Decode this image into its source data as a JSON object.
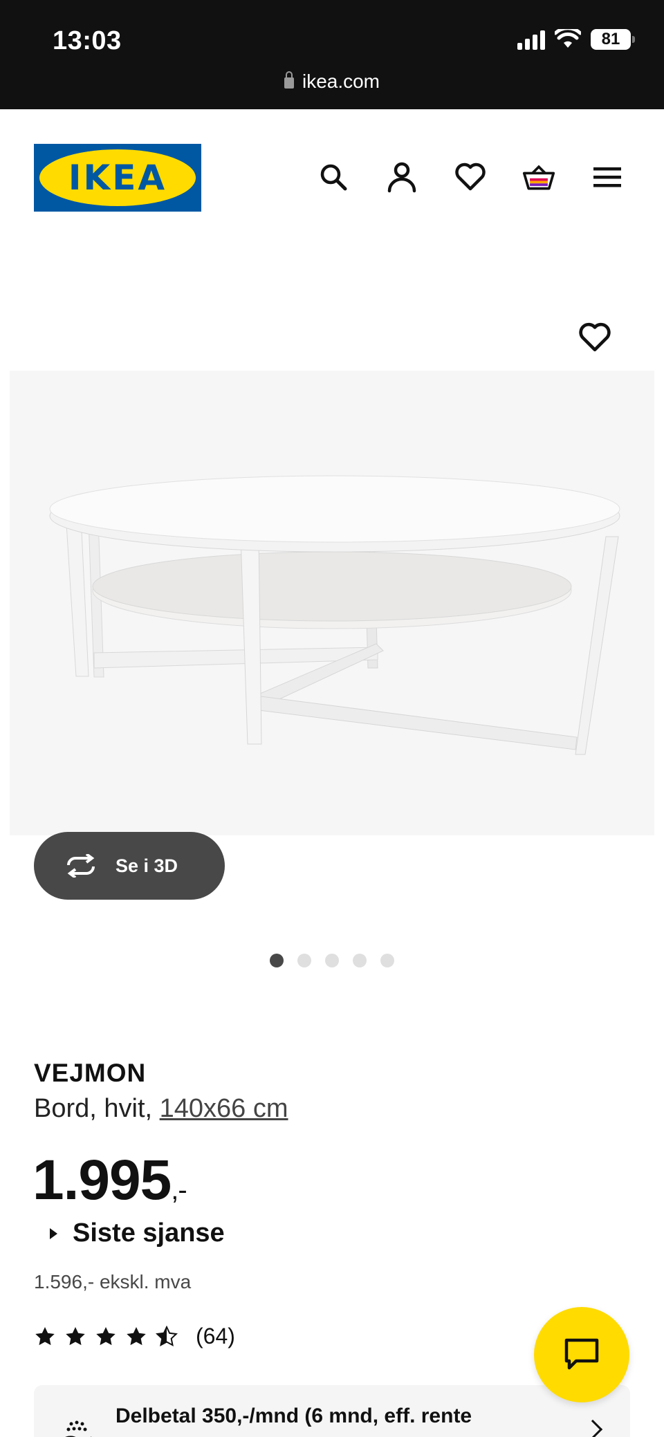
{
  "status_bar": {
    "time": "13:03",
    "battery": "81",
    "url": "ikea.com"
  },
  "header": {
    "logo_text": "IKEA",
    "icons": [
      "search-icon",
      "account-icon",
      "heart-icon",
      "basket-icon",
      "menu-icon"
    ]
  },
  "gallery": {
    "view_3d_label": "Se i 3D",
    "dot_count": 5,
    "active_dot": 1
  },
  "product": {
    "name": "VEJMON",
    "description": "Bord, hvit,",
    "size": "140x66 cm",
    "price_main": "1.995",
    "price_decimal": ",-",
    "last_chance_label": "Siste sjanse",
    "ex_vat": "1.596,- ekskl. mva",
    "rating": 4.5,
    "rating_count": "(64)"
  },
  "installment": {
    "text": "Delbetal 350,-/mnd (6 mnd, eff. rente"
  },
  "colors": {
    "ikea_blue": "#0058a3",
    "ikea_yellow": "#ffdb00",
    "dark_button": "#484848"
  }
}
